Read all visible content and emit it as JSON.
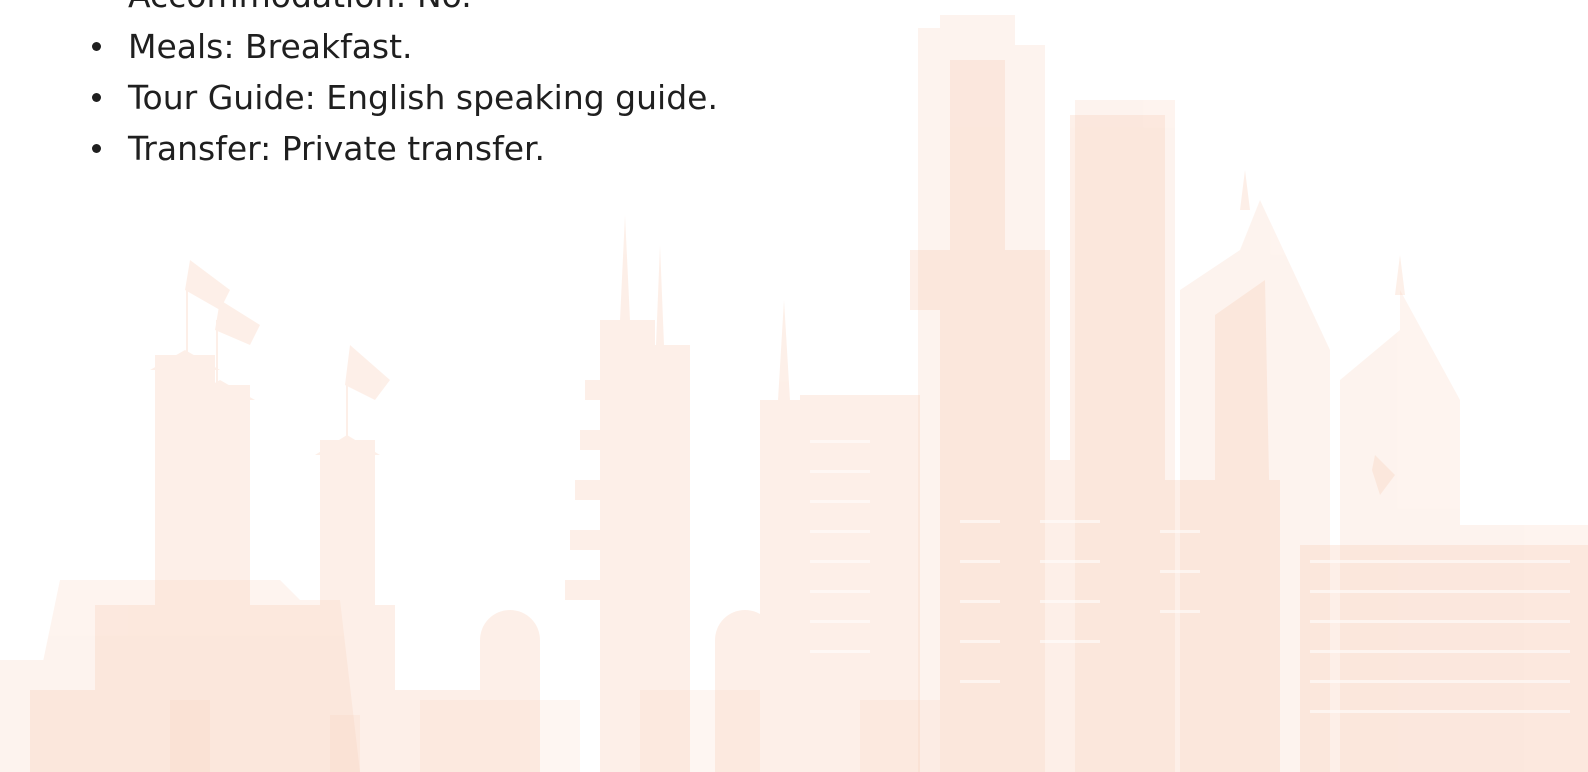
{
  "inclusions": {
    "items": [
      {
        "label": "Accommodation: No."
      },
      {
        "label": "Meals: Breakfast."
      },
      {
        "label": "Tour Guide: English speaking guide."
      },
      {
        "label": "Transfer: Private transfer."
      }
    ]
  },
  "background": {
    "icon": "city-skyline-illustration",
    "tint_color": "#f9cdb5"
  }
}
